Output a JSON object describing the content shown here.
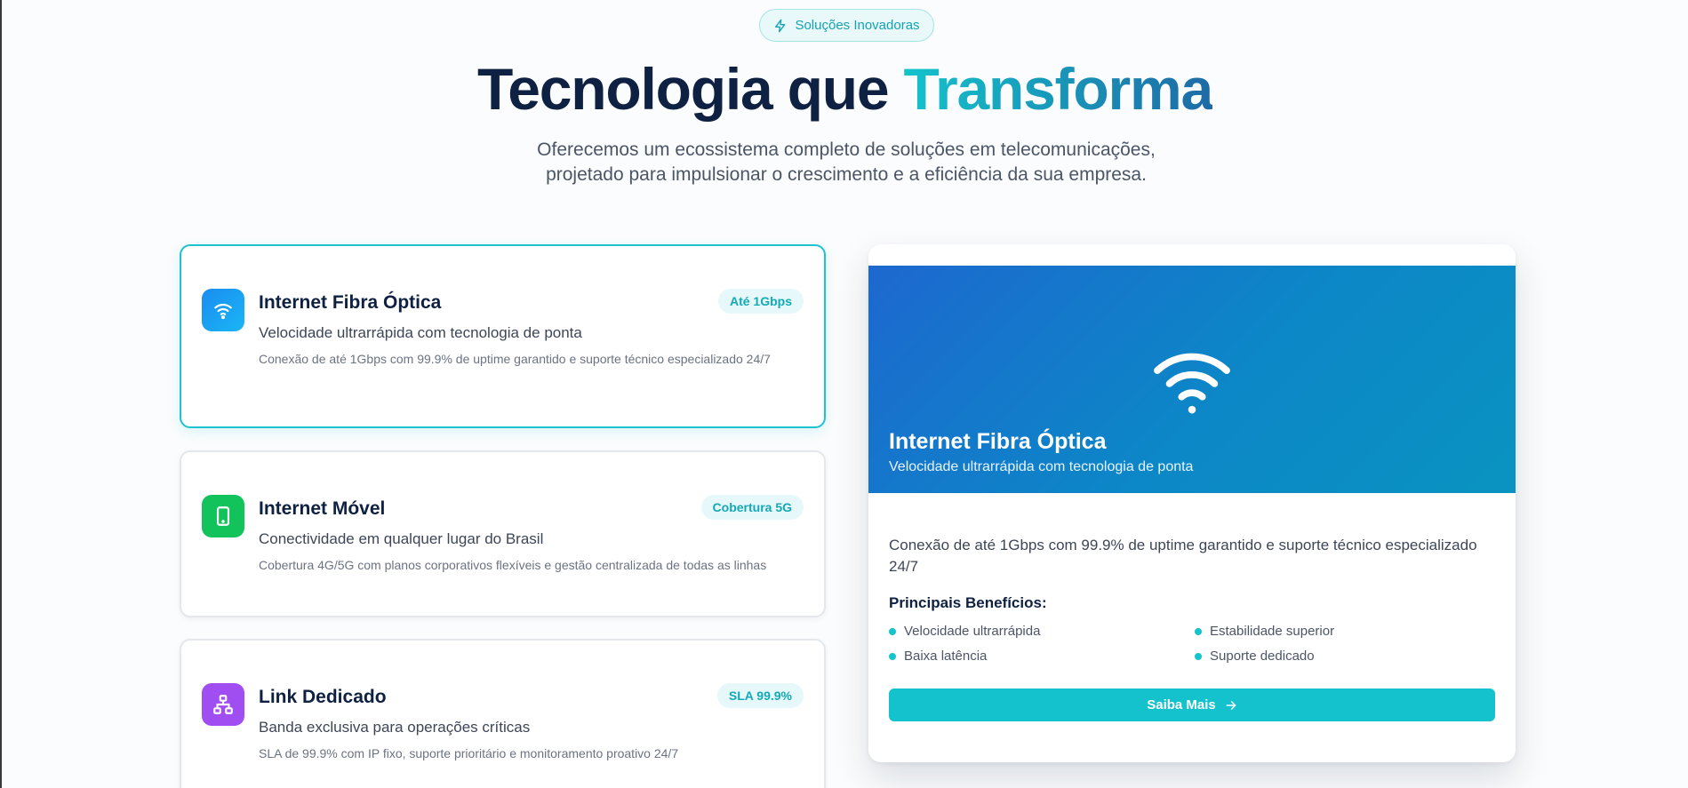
{
  "badge": {
    "icon": "lightning-icon",
    "label": "Soluções Inovadoras"
  },
  "heading": {
    "part1": "Tecnologia que ",
    "accent": "Transforma"
  },
  "subtitle": {
    "line1": "Oferecemos um ecossistema completo de soluções em telecomunicações,",
    "line2": "projetado para impulsionar o crescimento e a eficiência da sua empresa."
  },
  "services": [
    {
      "icon": "wifi-icon",
      "title": "Internet Fibra Óptica",
      "badge": "Até 1Gbps",
      "description": "Velocidade ultrarrápida com tecnologia de ponta",
      "detail": "Conexão de até 1Gbps com 99.9% de uptime garantido e suporte técnico especializado 24/7",
      "color": "#1a8cf0"
    },
    {
      "icon": "smartphone-icon",
      "title": "Internet Móvel",
      "badge": "Cobertura 5G",
      "description": "Conectividade em qualquer lugar do Brasil",
      "detail": "Cobertura 4G/5G com planos corporativos flexíveis e gestão centralizada de todas as linhas",
      "color": "#12c25a"
    },
    {
      "icon": "network-icon",
      "title": "Link Dedicado",
      "badge": "SLA 99.9%",
      "description": "Banda exclusiva para operações críticas",
      "detail": "SLA de 99.9% com IP fixo, suporte prioritário e monitoramento proativo 24/7",
      "color": "#a04df2"
    }
  ],
  "detail_panel": {
    "icon": "wifi-icon",
    "title": "Internet Fibra Óptica",
    "subtitle": "Velocidade ultrarrápida com tecnologia de ponta",
    "description": "Conexão de até 1Gbps com 99.9% de uptime garantido e suporte técnico especializado 24/7",
    "benefits_heading": "Principais Benefícios:",
    "benefits": [
      "Velocidade ultrarrápida",
      "Estabilidade superior",
      "Baixa latência",
      "Suporte dedicado"
    ],
    "button_label": "Saiba Mais"
  }
}
